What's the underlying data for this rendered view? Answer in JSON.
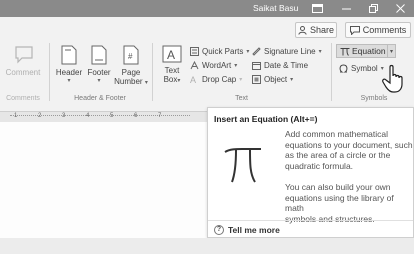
{
  "titlebar": {
    "user": "Saikat Basu",
    "icons": [
      "ribbon-display-icon",
      "minimize-icon",
      "restore-icon",
      "close-icon"
    ]
  },
  "actions": {
    "share_label": "Share",
    "comments_label": "Comments"
  },
  "ribbon": {
    "comments_group": {
      "comment_label": "Comment",
      "group_label": "Comments"
    },
    "header_footer": {
      "header_label": "Header",
      "footer_label": "Footer",
      "page_number_label1": "Page",
      "page_number_label2": "Number",
      "group_label": "Header & Footer"
    },
    "text_group": {
      "textbox_label1": "Text",
      "textbox_label2": "Box",
      "quick_parts": "Quick Parts",
      "wordart": "WordArt",
      "dropcap": "Drop Cap",
      "signature_line": "Signature Line",
      "date_time": "Date & Time",
      "object": "Object",
      "group_label": "Text"
    },
    "symbols_group": {
      "equation": "Equation",
      "symbol": "Symbol",
      "group_label": "Symbols"
    }
  },
  "ruler": {
    "marks": [
      "1",
      "2",
      "3",
      "4",
      "5",
      "6",
      "7"
    ]
  },
  "tooltip": {
    "title": "Insert an Equation (Alt+=)",
    "para1": [
      "Add common mathematical",
      "equations to your document, such",
      "as the area of a circle or the",
      "quadratic formula."
    ],
    "para2": [
      "You can also build your own",
      "equations using the library of math",
      "symbols and structures."
    ],
    "tell_me_more": "Tell me more"
  }
}
